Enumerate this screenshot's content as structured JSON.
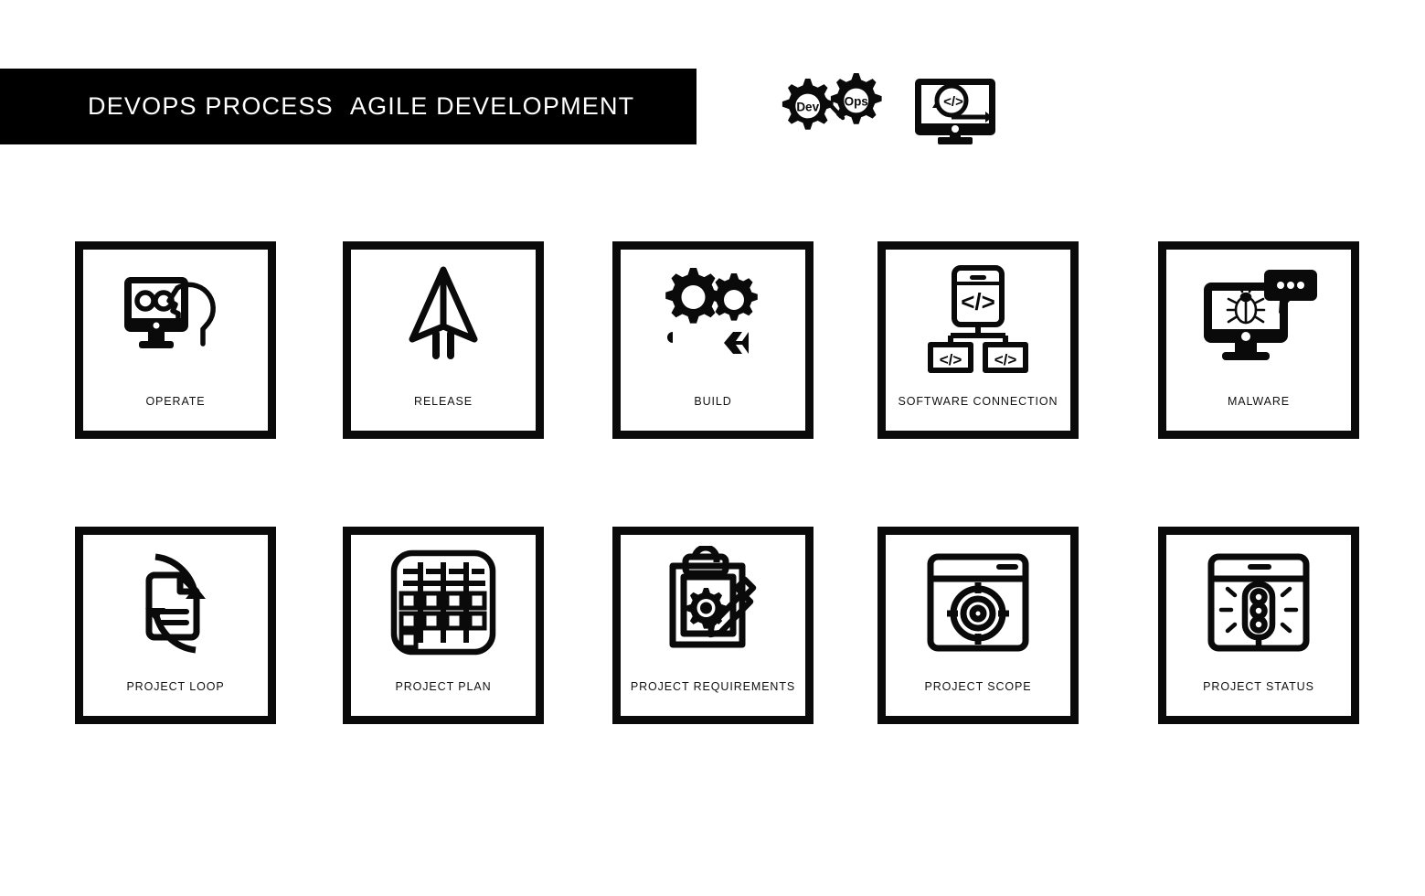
{
  "header": {
    "title_part1": "DEVOPS PROCESS",
    "title_part2": "AGILE DEVELOPMENT",
    "bar_color": "#000000",
    "text_color": "#ffffff",
    "logo": {
      "gear_left_label": "Dev",
      "gear_right_label": "Ops",
      "monitor_code_label": "</>",
      "icon_names": [
        "dev-gear-icon",
        "ops-gear-icon",
        "monitor-code-icon"
      ]
    }
  },
  "palette": {
    "ink": "#0a0a0a",
    "paper": "#ffffff",
    "label": "#111111"
  },
  "grid": {
    "rows": 2,
    "columns": 5,
    "cards": [
      {
        "label": "OPERATE",
        "icon": "monitor-infinity-head-icon",
        "row": 1,
        "col": 1
      },
      {
        "label": "RELEASE",
        "icon": "paper-plane-launch-icon",
        "row": 1,
        "col": 2
      },
      {
        "label": "BUILD",
        "icon": "gears-wrench-icon",
        "row": 1,
        "col": 3
      },
      {
        "label": "SOFTWARE CONNECTION",
        "icon": "code-nodes-network-icon",
        "row": 1,
        "col": 4
      },
      {
        "label": "MALWARE",
        "icon": "monitor-bug-alert-icon",
        "row": 1,
        "col": 5
      },
      {
        "label": "PROJECT LOOP",
        "icon": "document-refresh-loop-icon",
        "row": 2,
        "col": 1
      },
      {
        "label": "PROJECT PLAN",
        "icon": "gantt-board-icon",
        "row": 2,
        "col": 2
      },
      {
        "label": "PROJECT REQUIREMENTS",
        "icon": "clipboard-gear-pencil-icon",
        "row": 2,
        "col": 3
      },
      {
        "label": "PROJECT SCOPE",
        "icon": "browser-target-icon",
        "row": 2,
        "col": 4
      },
      {
        "label": "PROJECT STATUS",
        "icon": "browser-traffic-light-icon",
        "row": 2,
        "col": 5
      }
    ]
  }
}
